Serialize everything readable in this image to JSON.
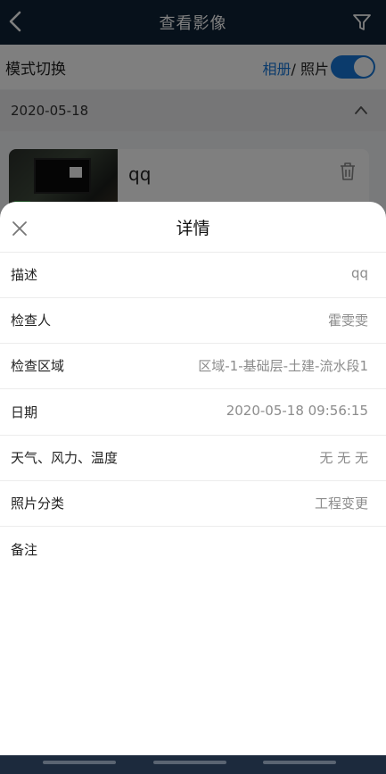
{
  "topbar": {
    "title": "查看影像",
    "back_icon": "chevron-left-icon",
    "filter_icon": "filter-icon"
  },
  "mode": {
    "label": "模式切换",
    "album": "相册",
    "separator": "/",
    "photo": "照片",
    "toggle_on": true
  },
  "date_group": {
    "date": "2020-05-18"
  },
  "card": {
    "name": "qq",
    "delete_icon": "trash-icon"
  },
  "sheet": {
    "title": "详情",
    "rows": [
      {
        "key": "描述",
        "value": "qq"
      },
      {
        "key": "检查人",
        "value": "霍雯雯"
      },
      {
        "key": "检查区域",
        "value": "区域-1-基础层-土建-流水段1"
      },
      {
        "key": "日期",
        "value": "2020-05-18 09:56:15"
      },
      {
        "key": "天气、风力、温度",
        "value": "无 无 无"
      },
      {
        "key": "照片分类",
        "value": "工程变更"
      },
      {
        "key": "备注",
        "value": ""
      }
    ]
  },
  "colors": {
    "accent": "#1677d9",
    "header_bg": "#0e2237"
  }
}
